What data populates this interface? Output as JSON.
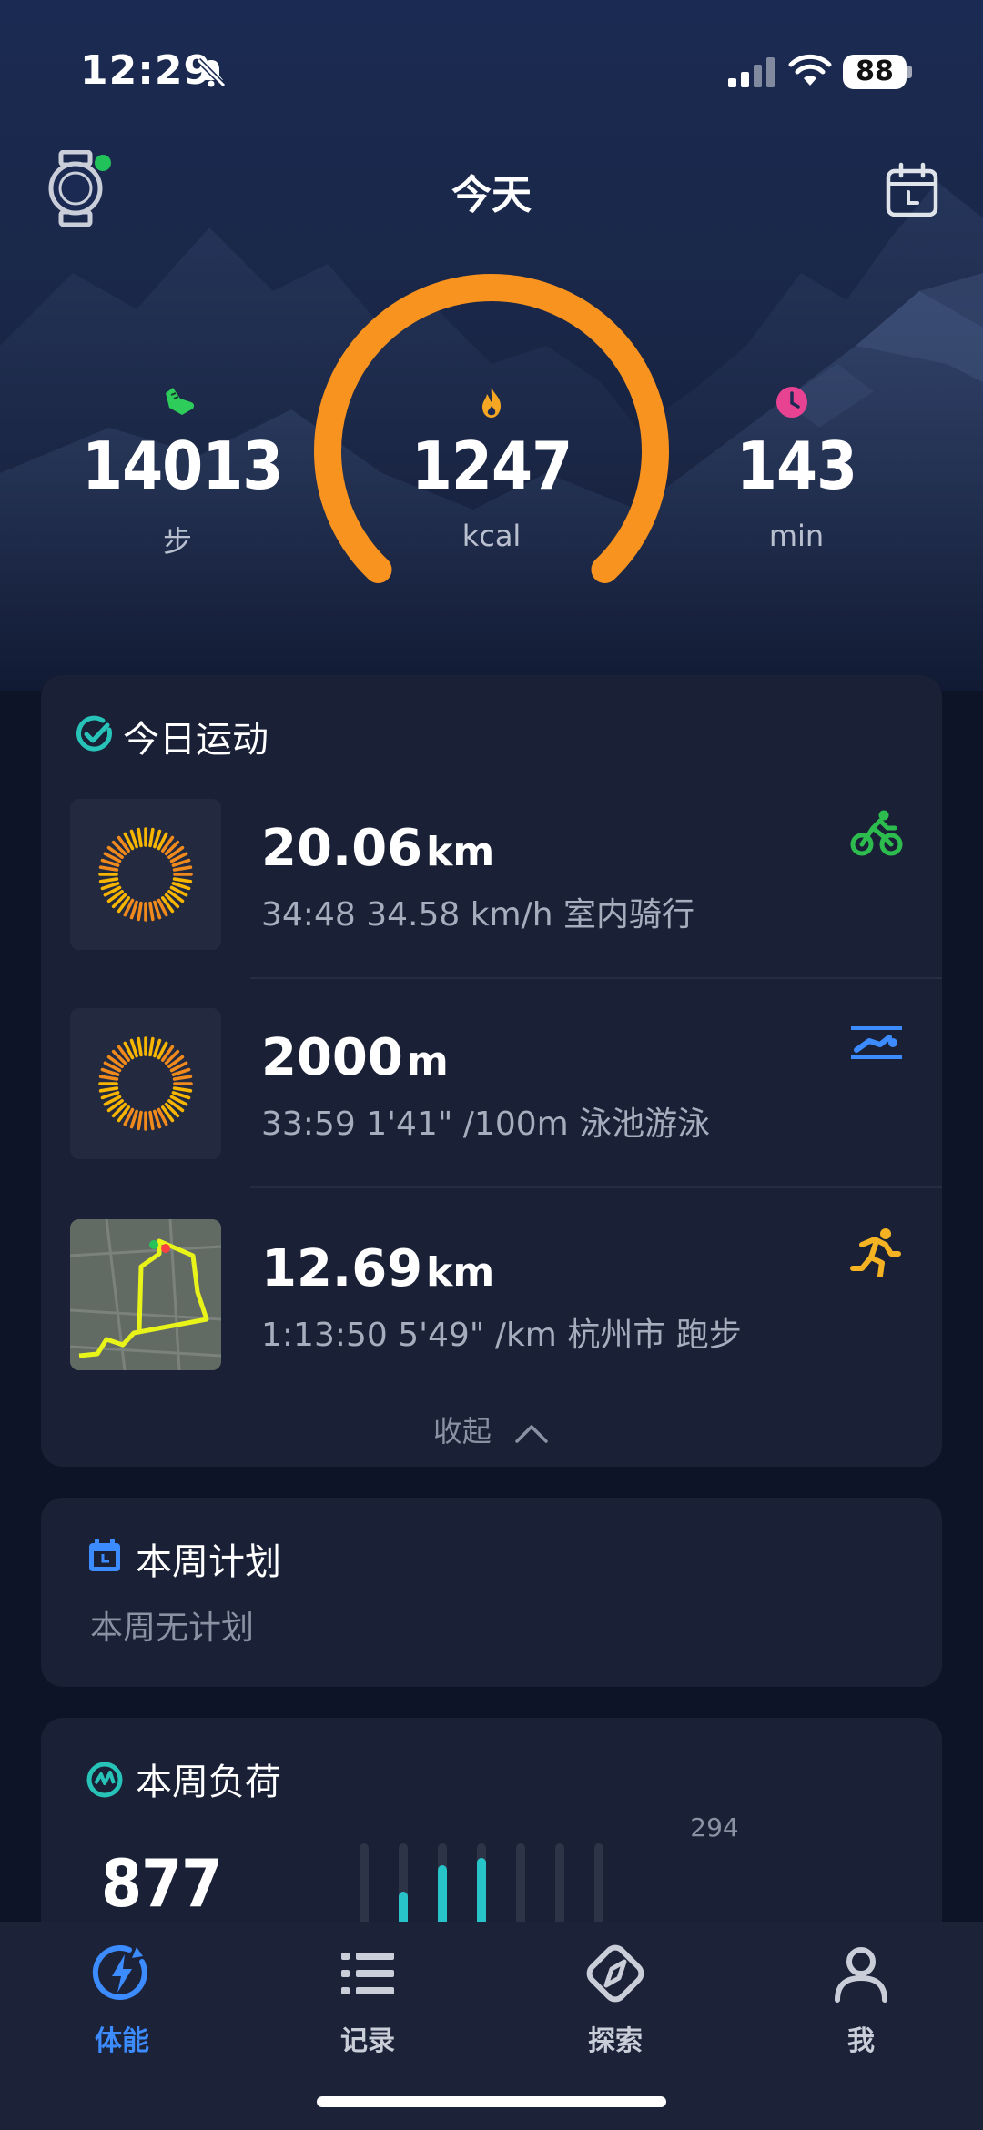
{
  "status_bar": {
    "time": "12:29",
    "battery": "88"
  },
  "header": {
    "title": "今天"
  },
  "stats": {
    "steps": {
      "value": "14013",
      "unit": "步",
      "icon": "shoe-icon",
      "color": "#2ecc5a"
    },
    "calories": {
      "value": "1247",
      "unit": "kcal",
      "icon": "flame-icon",
      "color": "#f5a623"
    },
    "minutes": {
      "value": "143",
      "unit": "min",
      "icon": "clock-icon",
      "color": "#e84393"
    }
  },
  "gauge": {
    "color": "#f7931e",
    "progress": 1.0
  },
  "today_exercise": {
    "title": "今日运动",
    "activities": [
      {
        "main": "20.06",
        "unit": "km",
        "sub": "34:48  34.58 km/h 室内骑行",
        "icon": "cycling-icon",
        "color": "#2dbd4e"
      },
      {
        "main": "2000",
        "unit": "m",
        "sub": "33:59  1'41\" /100m 泳池游泳",
        "icon": "swimming-icon",
        "color": "#3c8bff"
      },
      {
        "main": "12.69",
        "unit": "km",
        "sub": "1:13:50  5'49\" /km 杭州市 跑步",
        "icon": "running-icon",
        "color": "#f5b323"
      }
    ],
    "collapse_label": "收起"
  },
  "weekly_plan": {
    "title": "本周计划",
    "empty_text": "本周无计划"
  },
  "weekly_load": {
    "title": "本周负荷",
    "value": "877",
    "peak_label": "294",
    "bars": [
      0.18,
      0.52,
      0.78,
      0.85,
      0,
      0,
      0
    ]
  },
  "nav": {
    "items": [
      {
        "label": "体能",
        "icon": "fitness-icon",
        "active": true
      },
      {
        "label": "记录",
        "icon": "list-icon",
        "active": false
      },
      {
        "label": "探索",
        "icon": "compass-icon",
        "active": false
      },
      {
        "label": "我",
        "icon": "profile-icon",
        "active": false
      }
    ]
  }
}
